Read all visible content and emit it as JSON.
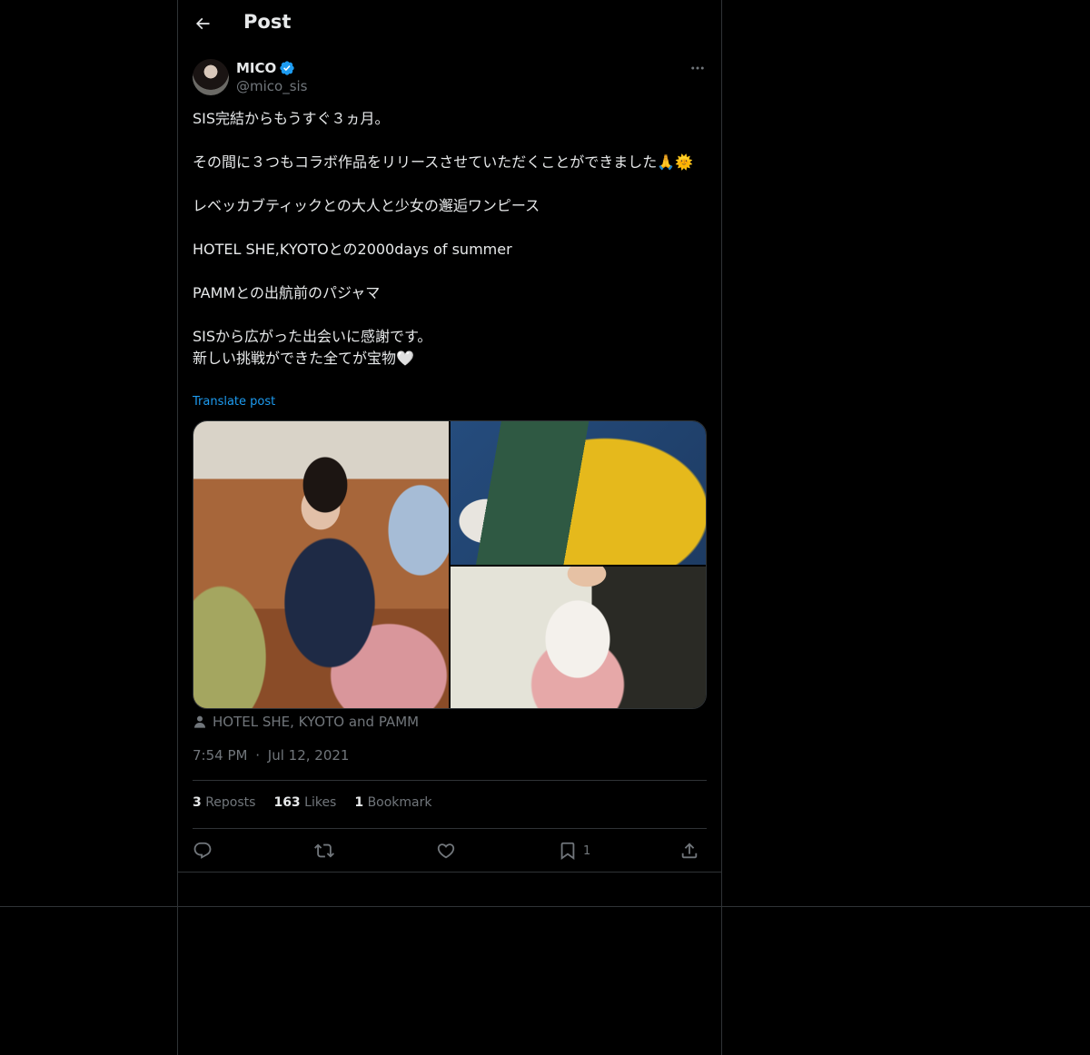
{
  "header": {
    "title": "Post",
    "back_icon": "arrow-left-icon"
  },
  "author": {
    "display_name": "MICO",
    "handle": "@mico_sis",
    "verified": true,
    "verified_color": "#1d9bf0"
  },
  "tweet": {
    "text": "SIS完結からもうすぐ３ヵ月。\n\nその間に３つもコラボ作品をリリースさせていただくことができました🙏🌞\n\nレベッカブティックとの大人と少女の邂逅ワンピース\n\nHOTEL SHE,KYOTOとの2000days of summer\n\nPAMMとの出航前のパジャマ\n\nSISから広がった出会いに感謝です。\n新しい挑戦ができた全てが宝物🤍",
    "translate_label": "Translate post",
    "tagged": "HOTEL SHE, KYOTO and PAMM",
    "time": "7:54 PM",
    "separator": "·",
    "date": "Jul 12, 2021"
  },
  "stats": {
    "reposts_count": "3",
    "reposts_label": "Reposts",
    "likes_count": "163",
    "likes_label": "Likes",
    "bookmarks_count": "1",
    "bookmarks_label": "Bookmark"
  },
  "actions": {
    "bookmark_count": "1"
  },
  "colors": {
    "background": "#000000",
    "text": "#e7e9ea",
    "secondary": "#71767b",
    "border": "#2f3336",
    "accent": "#1d9bf0"
  }
}
